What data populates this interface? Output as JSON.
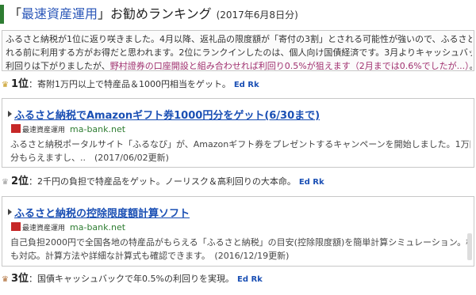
{
  "header": {
    "open_bracket": "「",
    "brand": "最速資産運用",
    "close_bracket": "」",
    "title_rest": "お勧めランキング",
    "date": "(2017年6月8日分)"
  },
  "intro": {
    "line1_a": "ふるさと納税が1位に返り咲きました。4月以降、返礼品の限度額が「寄付の3割」とされる可能性が強いので、ふるさと納税を検討中の方は、規",
    "line2": "れる前に利用する方がお得だと思われます。2位にランクインしたのは、個人向け国債経済です。3月よりキャッシュバックが一斉に減額され",
    "line3_a": "利回りは下がりましたが、",
    "line3_hl": "野村證券の口座開設と組み合わせれば利回り0.5%が狙えます（2月までは0.6%でしたが...）",
    "line3_b": "。"
  },
  "rankings": [
    {
      "crown": "♛",
      "rank_label": "1位",
      "desc": "：寄附1万円以上で特産品＆1000円相当をゲット。",
      "link": "Ed Rk",
      "card": {
        "title": "ふるさと納税でAmazonギフト券1000円分をゲット(6/30まで)",
        "site_name": "最速資産運用",
        "site_url": "ma-bank.net",
        "body_lines": [
          "ふるさと納税ポータルサイト「ふるなび」が、Amazonギフト券をプレゼントするキャンペーンを開始しました。1万円以上の寄附1回で1,000円",
          "分もらえますし、..　(2017/06/02更新)"
        ]
      }
    },
    {
      "crown": "♛",
      "rank_label": "2位",
      "desc": "：2千円の負担で特産品をゲット。ノーリスク＆高利回りの大本命。",
      "link": "Ed Rk",
      "card": {
        "title": "ふるさと納税の控除限度額計算ソフト",
        "site_name": "最速資産運用",
        "site_url": "ma-bank.net",
        "body_lines": [
          "自己負担2000円で全国各地の特産品がもらえる「ふるさと納税」の目安(控除限度額)を簡単計算シミュレーション。株式投資やFX等の分離課",
          "も対応。計算方法や詳細な計算式も確認できます。　(2016/12/19更新)"
        ]
      }
    },
    {
      "crown": "♛",
      "rank_label": "3位",
      "desc": "：国債キャッシュバックで年0.5%の利回りを実現。",
      "link": "Ed Rk"
    }
  ],
  "colors": {
    "accent_green": "#2e7d32",
    "link_blue": "#1a4fb4",
    "highlight": "#a0306f"
  }
}
